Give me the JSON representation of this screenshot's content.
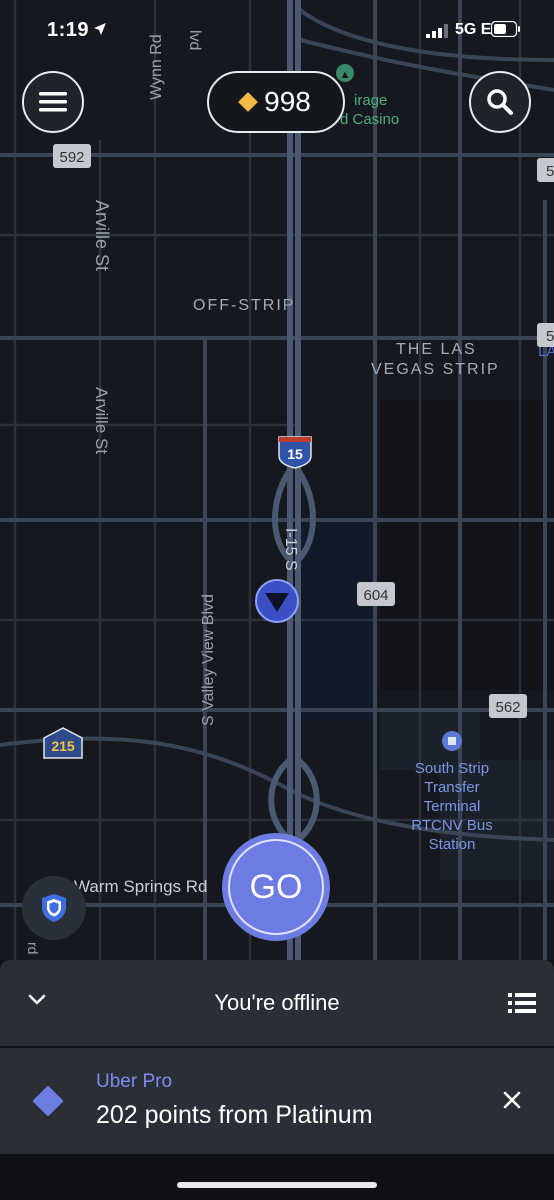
{
  "status_bar": {
    "time": "1:19",
    "network": "5G E"
  },
  "top_bar": {
    "points": "998"
  },
  "map": {
    "labels": {
      "wynn_rd": "Wynn Rd",
      "blvd": "lvd",
      "arville_st_1": "Arville St",
      "arville_st_2": "Arville St",
      "off_strip": "OFF-STRIP",
      "las_vegas_strip_1": "THE LAS",
      "las_vegas_strip_2": "VEGAS STRIP",
      "mirage_1": "irage",
      "mirage_2": "d Casino",
      "i15_s": "I-15 S",
      "valley_view": "S Valley View Blvd",
      "warm_springs": "Warm Springs Rd",
      "edge_rd": "rd",
      "south_strip_1": "South Strip",
      "south_strip_2": "Transfer",
      "south_strip_3": "Terminal",
      "south_strip_4": "RTCNV Bus",
      "south_strip_5": "Station",
      "edge_la": "LA"
    },
    "shields": {
      "r592": "592",
      "r5_top": "5",
      "r5_mid": "5",
      "i15": "15",
      "r604": "604",
      "r562": "562",
      "r215": "215"
    }
  },
  "go_button": {
    "label": "GO"
  },
  "sheet": {
    "status": "You're offline",
    "pro_title": "Uber Pro",
    "pro_subtitle": "202 points from Platinum"
  },
  "colors": {
    "accent": "#6d7ce3",
    "map_bg": "#15191f",
    "road": "#3a4556",
    "highway": "#4b5a72",
    "points_diamond": "#f5b942"
  }
}
